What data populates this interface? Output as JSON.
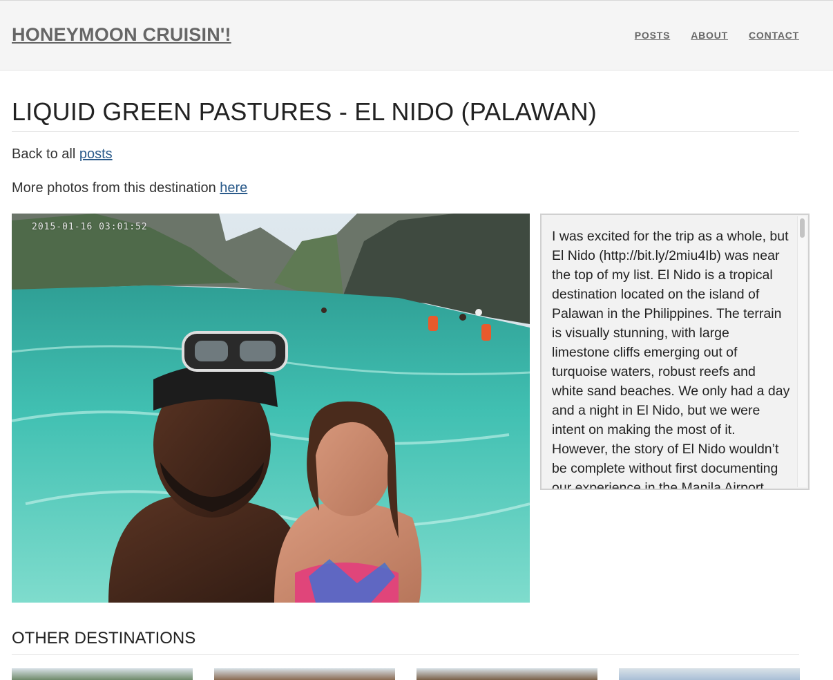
{
  "header": {
    "brand": "HONEYMOON CRUISIN'!",
    "nav": [
      "POSTS",
      "ABOUT",
      "CONTACT"
    ]
  },
  "post": {
    "title": "LIQUID GREEN PASTURES - EL NIDO (PALAWAN)",
    "back_prefix": "Back to all ",
    "back_link": "posts",
    "more_prefix": "More photos from this destination ",
    "more_link": "here",
    "photo_timestamp": "2015-01-16 03:01:52",
    "body": "I was excited for the trip as a whole, but El Nido (http://bit.ly/2miu4Ib) was near the top of my list. El Nido is a tropical destination located on the island of Palawan in the Philippines. The terrain is visually stunning, with large limestone cliffs emerging out of turquoise waters, robust reefs and white sand beaches. We only had a day and a night in El Nido, but we were intent on making the most of it. However, the story of El Nido wouldn’t be complete without first documenting our experience in the Manila Airport."
  },
  "other": {
    "title": "OTHER DESTINATIONS",
    "thumb_colors": [
      "#6f8a6a",
      "#8a6a52",
      "#7a6048",
      "#a9bfd6"
    ]
  }
}
